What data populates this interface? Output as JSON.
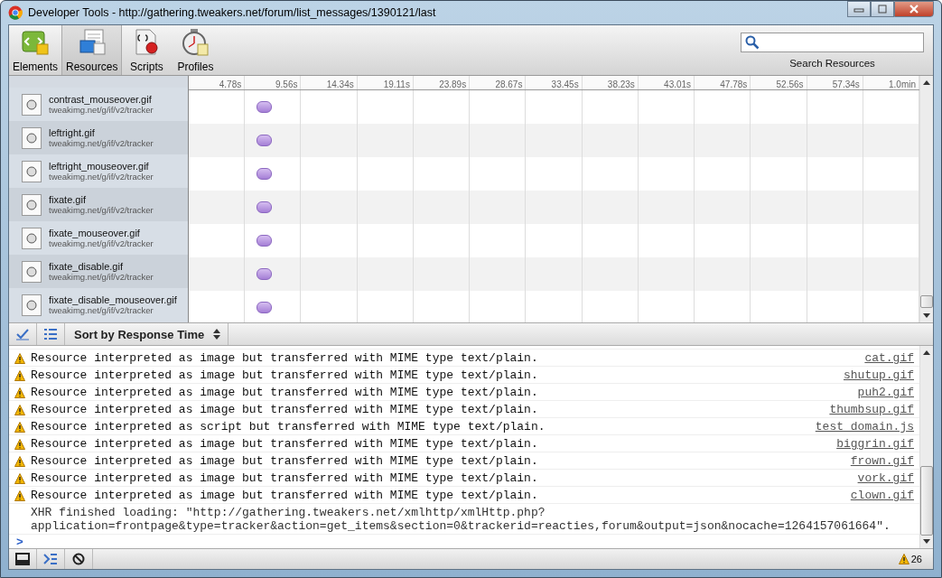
{
  "window": {
    "title": "Developer Tools - http://gathering.tweakers.net/forum/list_messages/1390121/last"
  },
  "tabs": [
    {
      "label": "Elements",
      "kind": "elements",
      "selected": false
    },
    {
      "label": "Resources",
      "kind": "resources",
      "selected": true
    },
    {
      "label": "Scripts",
      "kind": "scripts",
      "selected": false
    },
    {
      "label": "Profiles",
      "kind": "profiles",
      "selected": false
    }
  ],
  "search": {
    "label": "Search Resources"
  },
  "timeline": {
    "ticks": [
      "4.78s",
      "9.56s",
      "14.34s",
      "19.11s",
      "23.89s",
      "28.67s",
      "33.45s",
      "38.23s",
      "43.01s",
      "47.78s",
      "52.56s",
      "57.34s",
      "1.0min"
    ]
  },
  "resources": [
    {
      "name": "contrast_mouseover.gif",
      "path": "tweakimg.net/g/if/v2/tracker"
    },
    {
      "name": "leftright.gif",
      "path": "tweakimg.net/g/if/v2/tracker"
    },
    {
      "name": "leftright_mouseover.gif",
      "path": "tweakimg.net/g/if/v2/tracker"
    },
    {
      "name": "fixate.gif",
      "path": "tweakimg.net/g/if/v2/tracker"
    },
    {
      "name": "fixate_mouseover.gif",
      "path": "tweakimg.net/g/if/v2/tracker"
    },
    {
      "name": "fixate_disable.gif",
      "path": "tweakimg.net/g/if/v2/tracker"
    },
    {
      "name": "fixate_disable_mouseover.gif",
      "path": "tweakimg.net/g/if/v2/tracker"
    }
  ],
  "sort": {
    "label": "Sort by Response Time"
  },
  "messages": [
    {
      "kind": "warning",
      "text": "Resource interpreted as image but transferred with MIME type text/plain.",
      "source": "cat.gif"
    },
    {
      "kind": "warning",
      "text": "Resource interpreted as image but transferred with MIME type text/plain.",
      "source": "shutup.gif"
    },
    {
      "kind": "warning",
      "text": "Resource interpreted as image but transferred with MIME type text/plain.",
      "source": "puh2.gif"
    },
    {
      "kind": "warning",
      "text": "Resource interpreted as image but transferred with MIME type text/plain.",
      "source": "thumbsup.gif"
    },
    {
      "kind": "warning",
      "text": "Resource interpreted as script but transferred with MIME type text/plain.",
      "source": "test_domain.js"
    },
    {
      "kind": "warning",
      "text": "Resource interpreted as image but transferred with MIME type text/plain.",
      "source": "biggrin.gif"
    },
    {
      "kind": "warning",
      "text": "Resource interpreted as image but transferred with MIME type text/plain.",
      "source": "frown.gif"
    },
    {
      "kind": "warning",
      "text": "Resource interpreted as image but transferred with MIME type text/plain.",
      "source": "vork.gif"
    },
    {
      "kind": "warning",
      "text": "Resource interpreted as image but transferred with MIME type text/plain.",
      "source": "clown.gif"
    },
    {
      "kind": "log",
      "text": "XHR finished loading: \"http://gathering.tweakers.net/xmlhttp/xmlHttp.php?\napplication=frontpage&type=tracker&action=get_items&section=0&trackerid=reacties,forum&output=json&nocache=1264157061664\"."
    }
  ],
  "prompt": ">",
  "warning_count": "26"
}
